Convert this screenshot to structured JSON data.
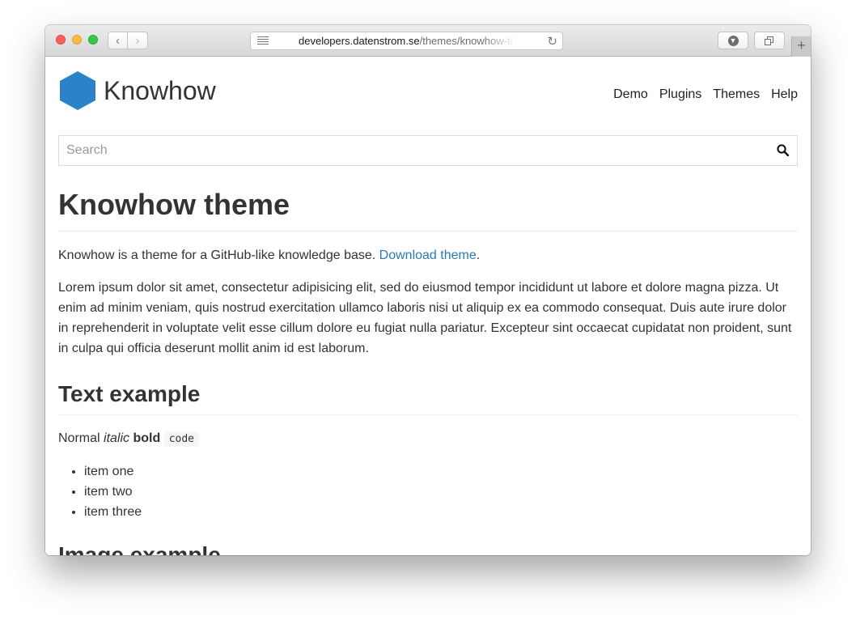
{
  "browser": {
    "url_host": "developers.datenstrom.se",
    "url_path": "/themes/knowhow-theme"
  },
  "site": {
    "name": "Knowhow",
    "logo_color": "#2a82c9",
    "nav": [
      "Demo",
      "Plugins",
      "Themes",
      "Help"
    ]
  },
  "search": {
    "placeholder": "Search"
  },
  "article": {
    "title": "Knowhow theme",
    "intro_text": "Knowhow is a theme for a GitHub-like knowledge base. ",
    "download_link": "Download theme",
    "intro_end": ".",
    "lorem": "Lorem ipsum dolor sit amet, consectetur adipisicing elit, sed do eiusmod tempor incididunt ut labore et dolore magna pizza. Ut enim ad minim veniam, quis nostrud exercitation ullamco laboris nisi ut aliquip ex ea commodo consequat. Duis aute irure dolor in reprehenderit in voluptate velit esse cillum dolore eu fugiat nulla pariatur. Excepteur sint occaecat cupidatat non proident, sunt in culpa qui officia deserunt mollit anim id est laborum.",
    "text_example": {
      "heading": "Text example",
      "normal": "Normal ",
      "italic": "italic",
      "bold": "bold",
      "code": "code",
      "items": [
        "item one",
        "item two",
        "item three"
      ]
    },
    "next_heading": "Image example"
  },
  "colors": {
    "link": "#2a7ab8",
    "text": "#333333"
  }
}
